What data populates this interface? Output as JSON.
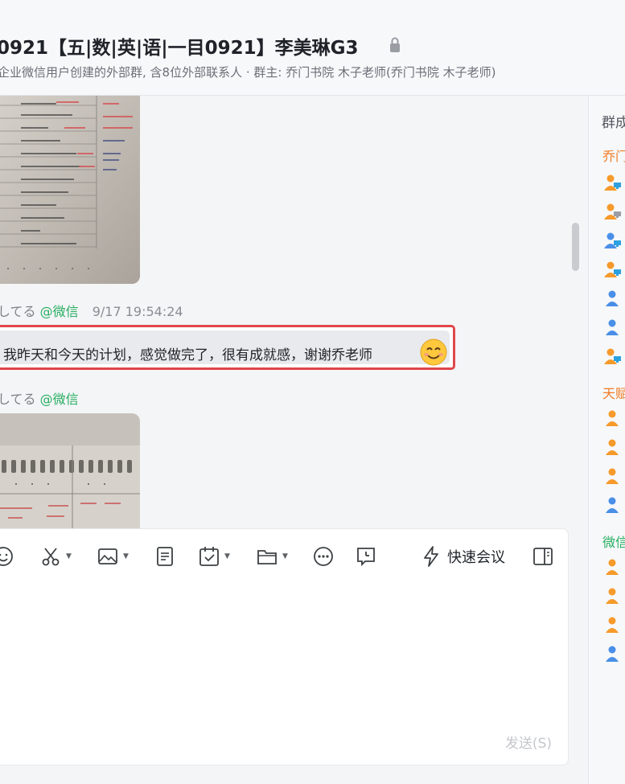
{
  "header": {
    "title": "0921【五|数|英|语|一目0921】李美琳G3",
    "subtitle": "企业微信用户创建的外部群, 含8位外部联系人 · 群主: 乔门书院 木子老师(乔门书院 木子老师)"
  },
  "messages": [
    {
      "type": "image",
      "description_icon": "notebook-photo"
    },
    {
      "sender": "してる",
      "source": "@微信",
      "time": "9/17 19:54:24",
      "text": "我昨天和今天的计划，感觉做完了，很有成就感，谢谢乔老师"
    },
    {
      "sender": "してる",
      "source": "@微信",
      "type": "image"
    }
  ],
  "composer": {
    "meeting_label": "快速会议",
    "send_label": "发送(S)"
  },
  "sidebar": {
    "heading": "群成",
    "groups": [
      {
        "label": "乔门",
        "color": "#f07b23"
      },
      {
        "label": "天赋",
        "color": "#f07b23"
      },
      {
        "label": "微信",
        "color": "#27ae60"
      }
    ]
  },
  "colors": {
    "accent_red": "#e0464a",
    "wechat_green": "#27ae60",
    "member_orange": "#f59a2b",
    "member_blue": "#4a8fe7"
  }
}
